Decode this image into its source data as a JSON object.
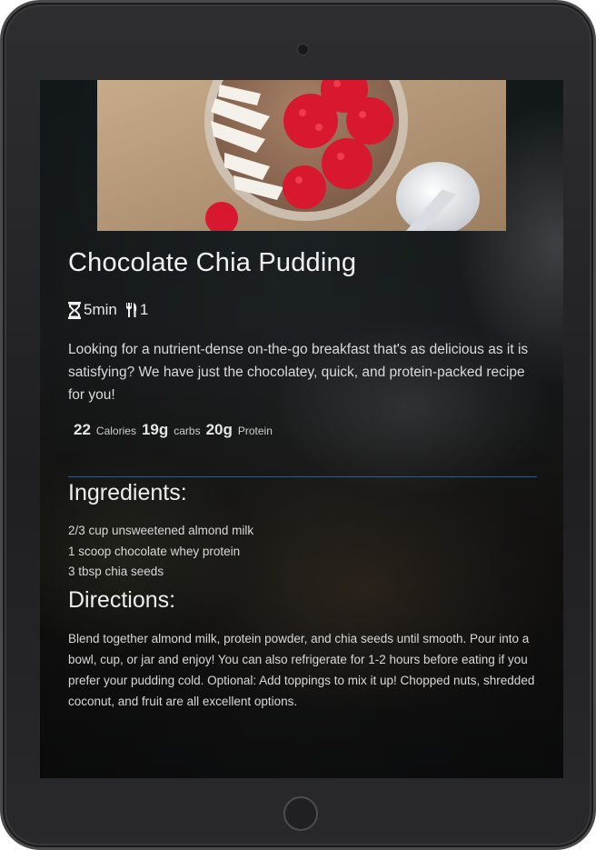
{
  "recipe": {
    "title": "Chocolate Chia Pudding",
    "time": "5min",
    "servings": "1",
    "description": "Looking for a nutrient-dense on-the-go breakfast that's as delicious as it is satisfying? We have just the chocolatey, quick, and protein-packed recipe for you!",
    "nutrition": {
      "calories": {
        "value": "22",
        "unit": "Calories"
      },
      "carbs": {
        "value": "19g",
        "unit": "carbs"
      },
      "protein": {
        "value": "20g",
        "unit": "Protein"
      }
    },
    "ingredients_heading": "Ingredients:",
    "ingredients": [
      "2/3 cup unsweetened almond milk",
      "1 scoop chocolate whey protein",
      "3 tbsp chia seeds"
    ],
    "directions_heading": "Directions:",
    "directions": "Blend together almond milk, protein powder, and chia seeds until smooth. Pour into a bowl, cup, or jar and enjoy! You can also refrigerate for 1-2 hours before eating if you prefer your pudding cold. Optional: Add toppings to mix it up! Chopped nuts, shredded coconut, and fruit are all excellent options."
  },
  "icons": {
    "time": "hourglass-icon",
    "servings": "utensils-icon"
  },
  "colors": {
    "divider": "#3f5a77",
    "text": "#dadada"
  }
}
